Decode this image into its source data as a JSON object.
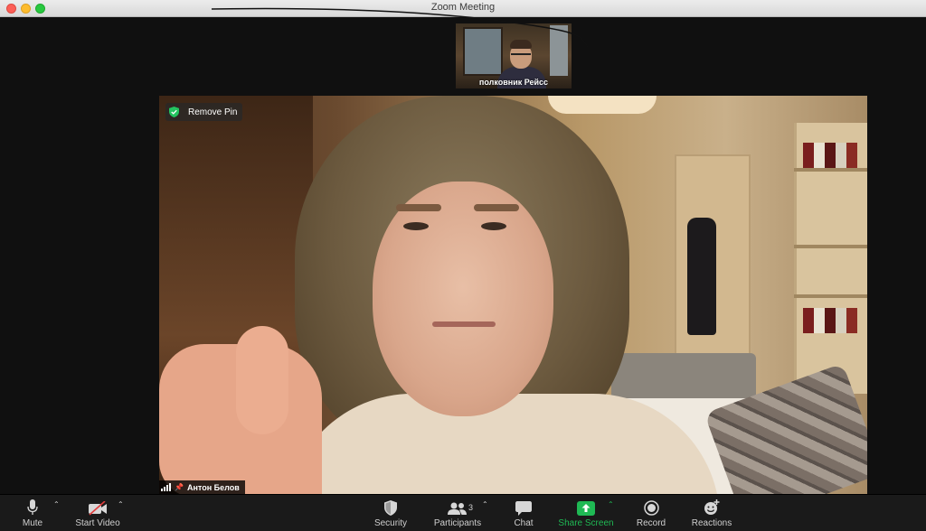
{
  "window": {
    "title": "Zoom Meeting"
  },
  "thumbnail": {
    "participant_name": "полковник Рейсс"
  },
  "main_video": {
    "pin_button_label": "Remove Pin",
    "speaker_name": "Антон Белов"
  },
  "toolbar": {
    "mute_label": "Mute",
    "start_video_label": "Start Video",
    "security_label": "Security",
    "participants_label": "Participants",
    "participants_count": "3",
    "chat_label": "Chat",
    "share_screen_label": "Share Screen",
    "record_label": "Record",
    "reactions_label": "Reactions"
  },
  "colors": {
    "share_green": "#1fb954",
    "shield_green": "#23c460",
    "close": "#fc5f57",
    "minimize": "#fdbc2e",
    "maximize": "#28c840"
  }
}
